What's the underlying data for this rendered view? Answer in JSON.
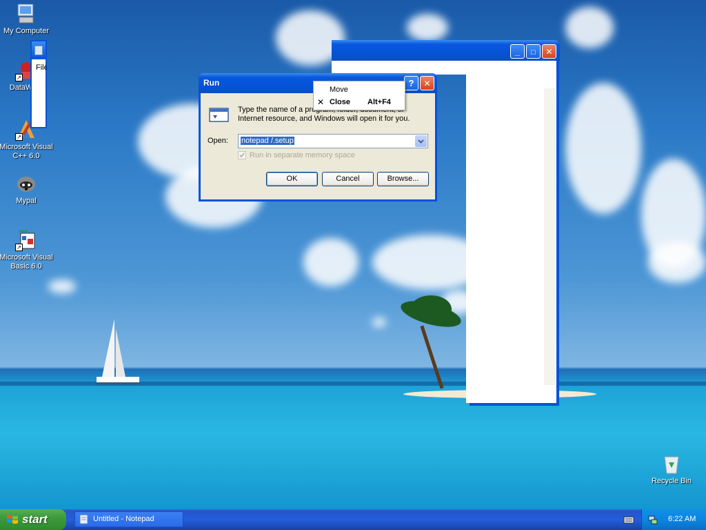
{
  "desktop_icons": [
    {
      "name": "my-computer-icon",
      "label": "My Computer"
    },
    {
      "name": "datawarehouse-icon",
      "label": "DataWa..."
    },
    {
      "name": "visual-cpp-icon",
      "label": "Microsoft Visual C++ 6.0"
    },
    {
      "name": "mypal-icon",
      "label": "Mypal"
    },
    {
      "name": "visual-basic-icon",
      "label": "Microsoft Visual Basic 6.0"
    },
    {
      "name": "recycle-bin-icon",
      "label": "Recycle Bin"
    }
  ],
  "background_window": {
    "menu_fragment": "File",
    "minimize_glyph": "_",
    "maximize_glyph": "□",
    "close_glyph": "✕"
  },
  "run_dialog": {
    "title": "Run",
    "help_glyph": "?",
    "close_glyph": "✕",
    "description_line1": "Type the name of a program, folder, document, or",
    "description_line2": "Internet resource, and Windows will open it for you.",
    "open_label": "Open:",
    "open_value": "notepad /.setup",
    "checkbox_label": "Run in separate memory space",
    "checkbox_checked": true,
    "ok_label": "OK",
    "cancel_label": "Cancel",
    "browse_label": "Browse..."
  },
  "context_menu": {
    "items": [
      {
        "label": "Move",
        "shortcut": "",
        "bold": false,
        "icon": ""
      },
      {
        "label": "Close",
        "shortcut": "Alt+F4",
        "bold": true,
        "icon": "✕"
      }
    ]
  },
  "taskbar": {
    "start_label": "start",
    "task_label": "Untitled - Notepad",
    "clock": "6:22 AM"
  },
  "colors": {
    "xp_blue": "#0553d8",
    "dialog_face": "#ece9d8",
    "start_green": "#3c9a3c",
    "tray_blue": "#0f8de8"
  }
}
